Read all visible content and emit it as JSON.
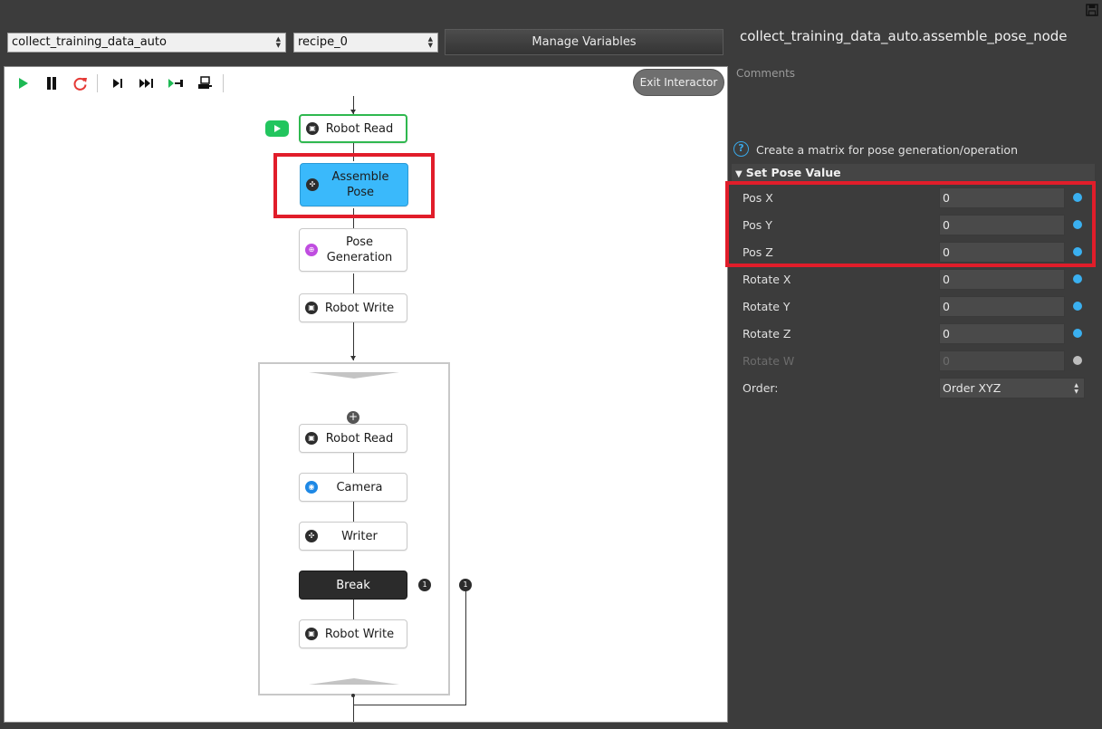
{
  "header": {
    "workflow_select": "collect_training_data_auto",
    "recipe_select": "recipe_0",
    "manage_variables_label": "Manage Variables"
  },
  "canvas": {
    "exit_interactor_label": "Exit Interactor",
    "toolbar": [
      "play-icon",
      "pause-icon",
      "restart-icon",
      "step-icon",
      "fast-forward-icon",
      "run-to-icon",
      "robot-debug-icon"
    ],
    "nodes": {
      "robot_read_1": "Robot Read",
      "assemble_pose_line1": "Assemble",
      "assemble_pose_line2": "Pose",
      "pose_generation_line1": "Pose",
      "pose_generation_line2": "Generation",
      "robot_write_1": "Robot Write",
      "robot_read_2": "Robot Read",
      "camera": "Camera",
      "writer": "Writer",
      "break": "Break",
      "robot_write_2": "Robot Write"
    },
    "badges": {
      "break_badge": "1",
      "loop_badge": "1"
    },
    "loop_add": "+"
  },
  "panel": {
    "title": "collect_training_data_auto.assemble_pose_node",
    "comments_label": "Comments",
    "help_icon": "?",
    "description": "Create a matrix for pose generation/operation",
    "section_title": "Set Pose Value",
    "properties": [
      {
        "label": "Pos X",
        "value": "0",
        "enabled": true
      },
      {
        "label": "Pos Y",
        "value": "0",
        "enabled": true
      },
      {
        "label": "Pos Z",
        "value": "0",
        "enabled": true
      },
      {
        "label": "Rotate X",
        "value": "0",
        "enabled": true
      },
      {
        "label": "Rotate Y",
        "value": "0",
        "enabled": true
      },
      {
        "label": "Rotate Z",
        "value": "0",
        "enabled": true
      },
      {
        "label": "Rotate W",
        "value": "0",
        "enabled": false
      }
    ],
    "order_label": "Order:",
    "order_value": "Order XYZ"
  },
  "colors": {
    "accent": "#3ab9fb",
    "active_node": "#2fb84f",
    "highlight": "#e11d2a",
    "panel_bg": "#3c3c3c"
  }
}
